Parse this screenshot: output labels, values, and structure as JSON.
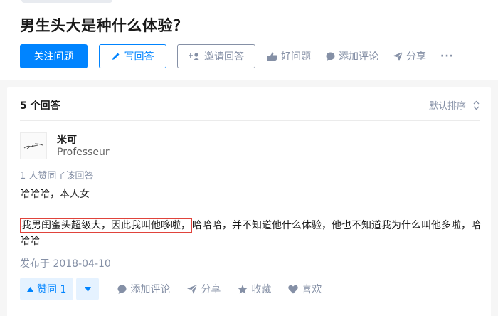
{
  "question": {
    "title": "男生头大是种什么体验？"
  },
  "actions": {
    "follow": "关注问题",
    "write": "写回答",
    "invite": "邀请回答",
    "good_question": "好问题",
    "add_comment": "添加评论",
    "share": "分享",
    "more": "···"
  },
  "answers_header": {
    "count": "5 个回答",
    "sort": "默认排序",
    "sort_icon": "up-down-chevron-icon"
  },
  "answer": {
    "author_name": "米可",
    "author_bio": "Professeur",
    "votes_note": "1 人赞同了该回答",
    "para1": "哈哈哈，本人女",
    "para2_highlight": "我男闺蜜头超级大，因此我叫他哆啦，",
    "para2_rest": "哈哈哈，并不知道他什么体验，他也不知道我为什么叫他多啦，哈哈哈",
    "date": "发布于 2018-04-10",
    "upvote": "赞同 1",
    "comment": "添加评论",
    "share": "分享",
    "collect": "收藏",
    "like": "喜欢"
  },
  "colors": {
    "brand_blue": "#0084ff",
    "gray_text": "#8590a6",
    "highlight_border": "#e0433b"
  }
}
